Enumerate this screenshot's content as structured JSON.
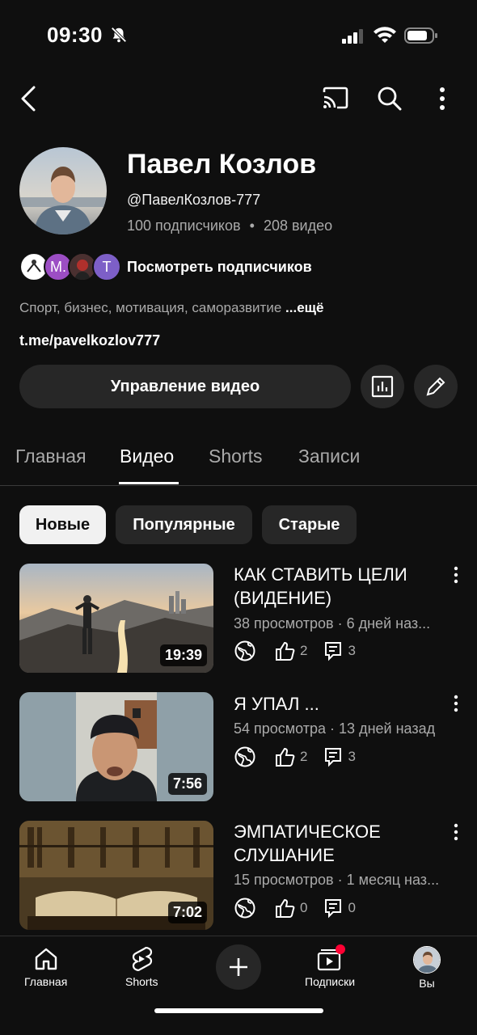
{
  "status_bar": {
    "time": "09:30"
  },
  "channel": {
    "name": "Павел Козлов",
    "handle": "@ПавелКозлов-777",
    "subscribers": "100 подписчиков",
    "separator": "•",
    "video_count": "208 видео",
    "view_subscribers": "Посмотреть подписчиков",
    "subscriber_avatars": [
      "",
      "M.",
      "",
      "T"
    ],
    "description": "Спорт, бизнес, мотивация, саморазвитие",
    "description_more": "...ещё",
    "link": "t.me/pavelkozlov777",
    "manage_button": "Управление видео"
  },
  "tabs": [
    {
      "label": "Главная",
      "active": false
    },
    {
      "label": "Видео",
      "active": true
    },
    {
      "label": "Shorts",
      "active": false
    },
    {
      "label": "Записи",
      "active": false
    }
  ],
  "chips": [
    {
      "label": "Новые",
      "active": true
    },
    {
      "label": "Популярные",
      "active": false
    },
    {
      "label": "Старые",
      "active": false
    }
  ],
  "videos": [
    {
      "title": "КАК СТАВИТЬ ЦЕЛИ (ВИДЕНИЕ)",
      "meta": "38 просмотров · 6 дней наз...",
      "duration": "19:39",
      "likes": "2",
      "comments": "3"
    },
    {
      "title": "Я УПАЛ ...",
      "meta": "54 просмотра · 13 дней назад",
      "duration": "7:56",
      "likes": "2",
      "comments": "3"
    },
    {
      "title": "ЭМПАТИЧЕСКОЕ СЛУШАНИЕ",
      "meta": "15 просмотров · 1 месяц наз...",
      "duration": "7:02",
      "likes": "0",
      "comments": "0"
    }
  ],
  "bottom_nav": {
    "home": "Главная",
    "shorts": "Shorts",
    "subscriptions": "Подписки",
    "you": "Вы"
  },
  "colors": {
    "background": "#0f0f0f",
    "chip": "#272727",
    "notification_dot": "#ff0033"
  }
}
